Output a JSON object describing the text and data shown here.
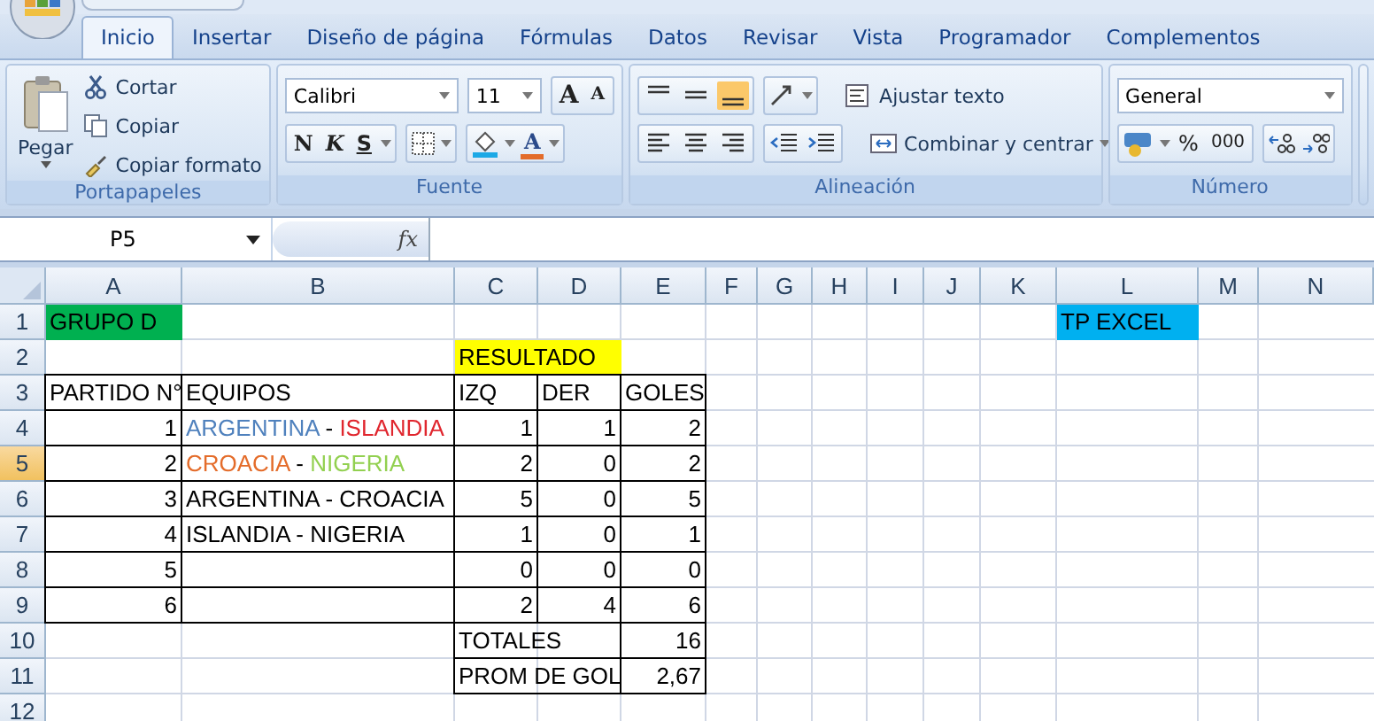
{
  "ribbon": {
    "tabs": [
      {
        "label": "Inicio",
        "selected": true
      },
      {
        "label": "Insertar",
        "selected": false
      },
      {
        "label": "Diseño de página",
        "selected": false
      },
      {
        "label": "Fórmulas",
        "selected": false
      },
      {
        "label": "Datos",
        "selected": false
      },
      {
        "label": "Revisar",
        "selected": false
      },
      {
        "label": "Vista",
        "selected": false
      },
      {
        "label": "Programador",
        "selected": false
      },
      {
        "label": "Complementos",
        "selected": false
      }
    ],
    "groups": [
      {
        "kind": "clipboard",
        "label": "Portapapeles",
        "paste": "Pegar",
        "cut": "Cortar",
        "copy": "Copiar",
        "format_painter": "Copiar formato"
      },
      {
        "kind": "font",
        "label": "Fuente",
        "font": "Calibri",
        "size": "11",
        "grow": "A",
        "shrink": "A",
        "bold": "N",
        "italic": "K",
        "underline": "S",
        "font_color": "A"
      },
      {
        "kind": "alignment",
        "label": "Alineación",
        "vertical": [
          {
            "selected": false
          },
          {
            "selected": false
          },
          {
            "selected": true
          }
        ],
        "wrap": "Ajustar texto",
        "merge": "Combinar y centrar"
      },
      {
        "kind": "number",
        "label": "Número",
        "format": "General",
        "percent": "%",
        "thousands": "000"
      }
    ]
  },
  "formula_bar": {
    "name_box": "P5",
    "fx": "fx"
  },
  "sheet": {
    "columns": [
      {
        "label": "A",
        "selected": false
      },
      {
        "label": "B",
        "selected": false
      },
      {
        "label": "C",
        "selected": false
      },
      {
        "label": "D",
        "selected": false
      },
      {
        "label": "E",
        "selected": false
      },
      {
        "label": "F",
        "selected": false
      },
      {
        "label": "G",
        "selected": false
      },
      {
        "label": "H",
        "selected": false
      },
      {
        "label": "I",
        "selected": false
      },
      {
        "label": "J",
        "selected": false
      },
      {
        "label": "K",
        "selected": false
      },
      {
        "label": "L",
        "selected": false
      },
      {
        "label": "M",
        "selected": false
      },
      {
        "label": "N",
        "selected": false
      }
    ],
    "rows": [
      {
        "label": "1",
        "selected": false,
        "cells": [
          {
            "text": "GRUPO D",
            "color": "#00b050"
          },
          {},
          {},
          {},
          {},
          {},
          {},
          {},
          {},
          {},
          {},
          {
            "text": "TP EXCEL",
            "color": "#00b0f0"
          }
        ]
      },
      {
        "label": "2",
        "selected": false,
        "cells": [
          {},
          {},
          {
            "text": "RESULTADO",
            "color": "#ffff00",
            "wide": true
          }
        ]
      },
      {
        "label": "3",
        "selected": false,
        "cells": [
          {
            "text": "PARTIDO N°",
            "boxed": true
          },
          {
            "text": "EQUIPOS",
            "boxed": true
          },
          {
            "text": "IZQ",
            "boxed": true
          },
          {
            "text": "DER",
            "boxed": true
          },
          {
            "text": "GOLES",
            "boxed": true
          }
        ]
      },
      {
        "label": "4",
        "selected": false,
        "cells": [
          {
            "text": "1",
            "kind": "number",
            "boxed": true
          },
          {
            "boxed": true,
            "parts": [
              {
                "text": "ARGENTINA",
                "color": "#4f81bd"
              },
              {
                "text": " - "
              },
              {
                "text": "ISLANDIA",
                "color": "#e0262e"
              }
            ]
          },
          {
            "text": "1",
            "kind": "number",
            "boxed": true
          },
          {
            "text": "1",
            "kind": "number",
            "boxed": true
          },
          {
            "text": "2",
            "kind": "number",
            "boxed": true
          }
        ]
      },
      {
        "label": "5",
        "selected": true,
        "cells": [
          {
            "text": "2",
            "kind": "number",
            "boxed": true
          },
          {
            "boxed": true,
            "parts": [
              {
                "text": "CROACIA",
                "color": "#e46c2a"
              },
              {
                "text": " - "
              },
              {
                "text": "NIGERIA",
                "color": "#92d050"
              }
            ]
          },
          {
            "text": "2",
            "kind": "number",
            "boxed": true
          },
          {
            "text": "0",
            "kind": "number",
            "boxed": true
          },
          {
            "text": "2",
            "kind": "number",
            "boxed": true
          }
        ]
      },
      {
        "label": "6",
        "selected": false,
        "cells": [
          {
            "text": "3",
            "kind": "number",
            "boxed": true
          },
          {
            "text": "ARGENTINA - CROACIA",
            "boxed": true
          },
          {
            "text": "5",
            "kind": "number",
            "boxed": true
          },
          {
            "text": "0",
            "kind": "number",
            "boxed": true
          },
          {
            "text": "5",
            "kind": "number",
            "boxed": true
          }
        ]
      },
      {
        "label": "7",
        "selected": false,
        "cells": [
          {
            "text": "4",
            "kind": "number",
            "boxed": true
          },
          {
            "text": "ISLANDIA - NIGERIA",
            "boxed": true
          },
          {
            "text": "1",
            "kind": "number",
            "boxed": true
          },
          {
            "text": "0",
            "kind": "number",
            "boxed": true
          },
          {
            "text": "1",
            "kind": "number",
            "boxed": true
          }
        ]
      },
      {
        "label": "8",
        "selected": false,
        "cells": [
          {
            "text": "5",
            "kind": "number",
            "boxed": true
          },
          {
            "boxed": true
          },
          {
            "text": "0",
            "kind": "number",
            "boxed": true
          },
          {
            "text": "0",
            "kind": "number",
            "boxed": true
          },
          {
            "text": "0",
            "kind": "number",
            "boxed": true
          }
        ]
      },
      {
        "label": "9",
        "selected": false,
        "cells": [
          {
            "text": "6",
            "kind": "number",
            "boxed": true
          },
          {
            "boxed": true
          },
          {
            "text": "2",
            "kind": "number",
            "boxed": true
          },
          {
            "text": "4",
            "kind": "number",
            "boxed": true
          },
          {
            "text": "6",
            "kind": "number",
            "boxed": true
          }
        ]
      },
      {
        "label": "10",
        "selected": false,
        "cells": [
          {},
          {},
          {
            "text": "TOTALES",
            "boxed": true,
            "wide": true
          },
          {
            "text": "16",
            "kind": "number",
            "boxed": true
          }
        ]
      },
      {
        "label": "11",
        "selected": false,
        "cells": [
          {},
          {},
          {
            "text": "PROM DE GOL",
            "boxed": true,
            "wide": true
          },
          {
            "text": "2,67",
            "kind": "number",
            "boxed": true
          }
        ]
      },
      {
        "label": "12",
        "selected": false,
        "cells": []
      }
    ]
  }
}
